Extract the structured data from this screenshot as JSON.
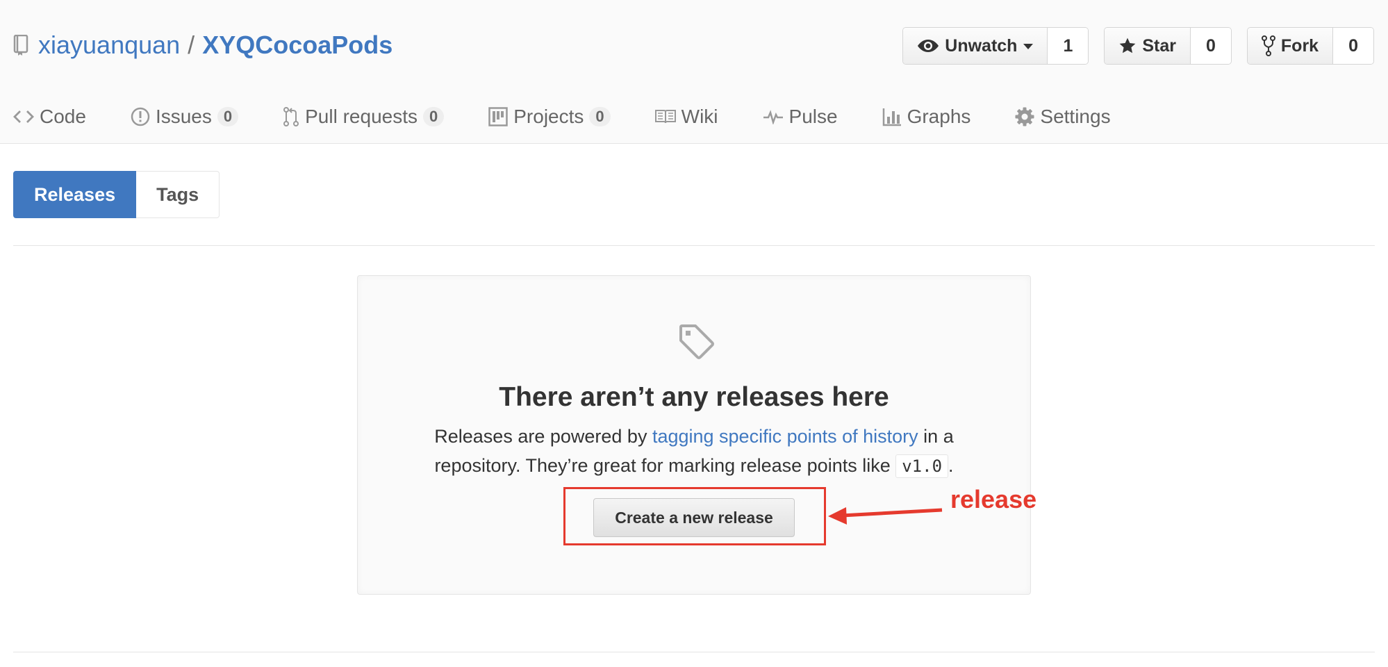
{
  "repo": {
    "owner": "xiayuanquan",
    "separator": "/",
    "name": "XYQCocoaPods"
  },
  "actions": {
    "watch": {
      "label": "Unwatch",
      "count": "1"
    },
    "star": {
      "label": "Star",
      "count": "0"
    },
    "fork": {
      "label": "Fork",
      "count": "0"
    }
  },
  "nav": {
    "code": {
      "label": "Code"
    },
    "issues": {
      "label": "Issues",
      "count": "0"
    },
    "pull_requests": {
      "label": "Pull requests",
      "count": "0"
    },
    "projects": {
      "label": "Projects",
      "count": "0"
    },
    "wiki": {
      "label": "Wiki"
    },
    "pulse": {
      "label": "Pulse"
    },
    "graphs": {
      "label": "Graphs"
    },
    "settings": {
      "label": "Settings"
    }
  },
  "subnav": {
    "releases": "Releases",
    "tags": "Tags"
  },
  "blankslate": {
    "title": "There aren’t any releases here",
    "text_before": "Releases are powered by ",
    "link": "tagging specific points of history",
    "text_middle": " in a repository. They’re great for marking release points like ",
    "code": "v1.0",
    "text_after": ".",
    "button": "Create a new release"
  },
  "annotation": {
    "label": "release",
    "color": "#e53a2e"
  },
  "colors": {
    "accent": "#4078c0",
    "header_bg": "#fafafa",
    "text": "#333333"
  }
}
